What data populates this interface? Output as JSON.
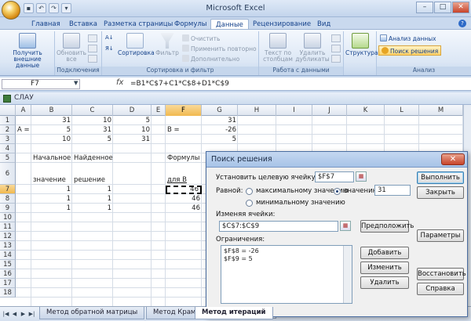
{
  "app": {
    "title": "Microsoft Excel"
  },
  "ribbon_tabs": [
    "Главная",
    "Вставка",
    "Разметка страницы",
    "Формулы",
    "Данные",
    "Рецензирование",
    "Вид"
  ],
  "ribbon": {
    "get_external": "Получить внешние данные",
    "refresh_all": "Обновить все",
    "group_connections": "Подключения",
    "sort": "Сортировка",
    "filter": "Фильтр",
    "clear": "Очистить",
    "reapply": "Применить повторно",
    "advanced": "Дополнительно",
    "group_sort_filter": "Сортировка и фильтр",
    "text_to_columns": "Текст по столбцам",
    "remove_duplicates": "Удалить дубликаты",
    "group_data_tools": "Работа с данными",
    "outline": "Структура",
    "data_analysis": "Анализ данных",
    "solver": "Поиск решения",
    "group_analysis": "Анализ"
  },
  "formula_bar": {
    "name_box": "F7",
    "fx": "fx",
    "formula": "=B1*C$7+C1*C$8+D1*C$9"
  },
  "workbook": {
    "title": "СЛАУ"
  },
  "columns": [
    "A",
    "B",
    "C",
    "D",
    "E",
    "F",
    "G",
    "H",
    "I",
    "J",
    "K",
    "L",
    "M"
  ],
  "rows": [
    "1",
    "2",
    "3",
    "4",
    "5",
    "6",
    "7",
    "8",
    "9",
    "10",
    "11",
    "12",
    "13",
    "14",
    "15",
    "16",
    "17",
    "18"
  ],
  "cells": {
    "B1": "31",
    "C1": "10",
    "D1": "5",
    "G1": "31",
    "A2": "A =",
    "B2": "5",
    "C2": "31",
    "D2": "10",
    "F2": "B =",
    "G2": "-26",
    "B3": "10",
    "C3": "5",
    "D3": "31",
    "G3": "5",
    "B5": "Начальное",
    "C5": "Найденное",
    "F5": "Формулы",
    "B6": "значение",
    "C6": "решение",
    "F6": "для B",
    "B7": "1",
    "C7": "1",
    "F7": "46",
    "B8": "1",
    "C8": "1",
    "F8": "46",
    "B9": "1",
    "C9": "1",
    "F9": "46"
  },
  "sheet_tabs": [
    "Метод обратной матрицы",
    "Метод Крамера",
    "Метод итераций"
  ],
  "sheet_active": "Метод итераций",
  "solver": {
    "title": "Поиск решения",
    "target_label": "Установить целевую ячейку:",
    "target_value": "$F$7",
    "equal_label": "Равной:",
    "opt_max": "максимальному значению",
    "opt_value": "значению:",
    "value_input": "31",
    "opt_min": "минимальному значению",
    "changing_label": "Изменяя ячейки:",
    "changing_value": "$C$7:$C$9",
    "guess": "Предположить",
    "constraints_label": "Ограничения:",
    "constraints": [
      "$F$8 = -26",
      "$F$9 = 5"
    ],
    "add": "Добавить",
    "change": "Изменить",
    "delete": "Удалить",
    "execute": "Выполнить",
    "close": "Закрыть",
    "params": "Параметры",
    "restore": "Восстановить",
    "help": "Справка"
  }
}
